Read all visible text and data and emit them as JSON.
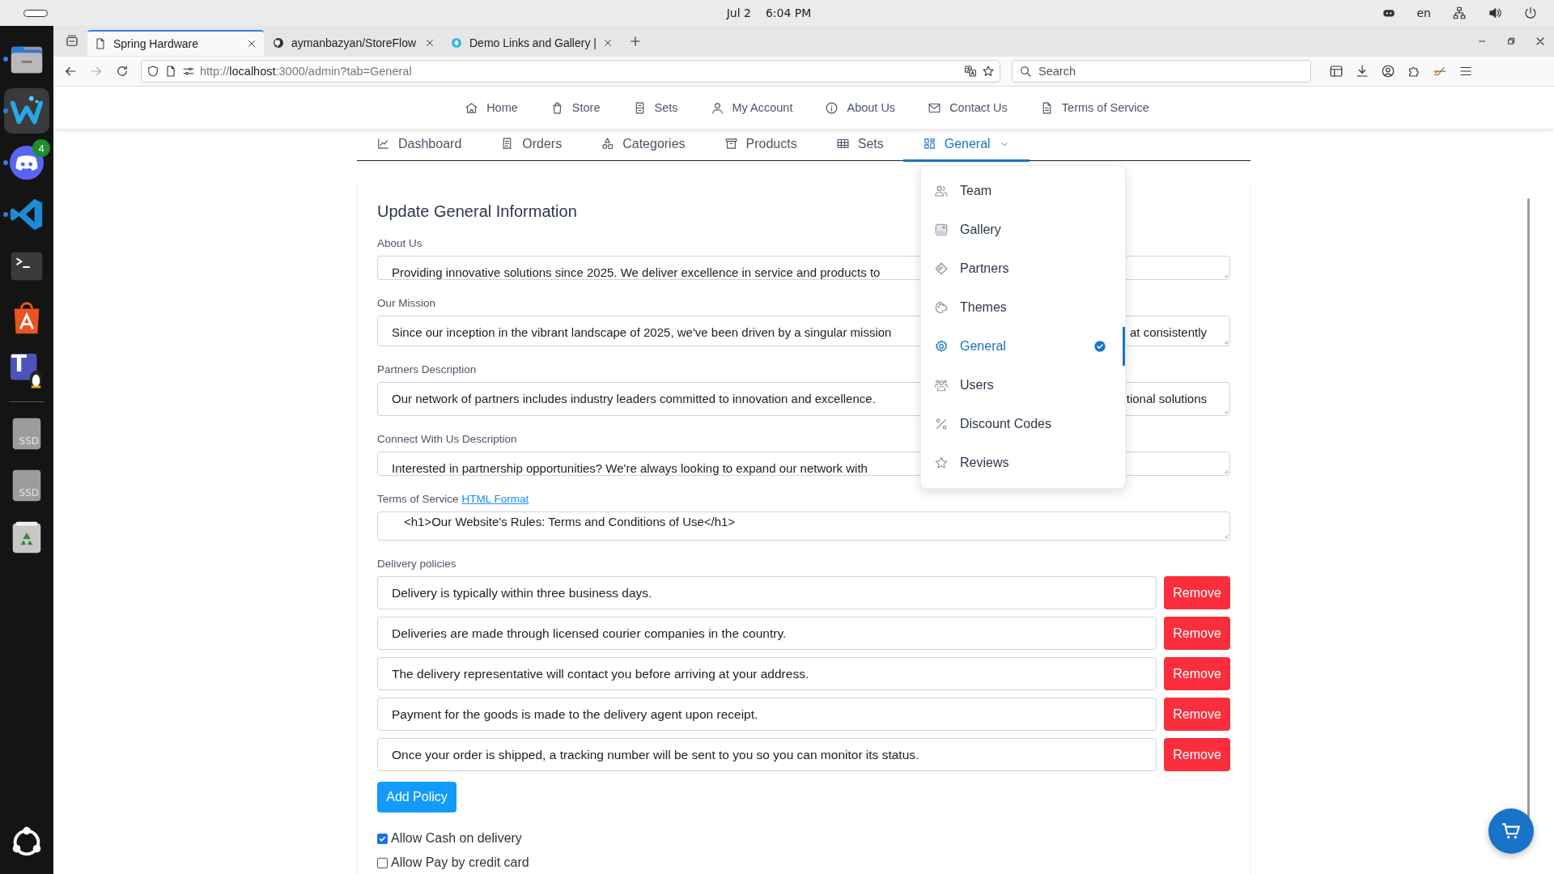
{
  "system_bar": {
    "date": "Jul 2",
    "time": "6:04 PM",
    "language": "en"
  },
  "dock": {
    "apps": [
      {
        "kind": "files",
        "running": true,
        "selected": false
      },
      {
        "kind": "wave",
        "running": true,
        "selected": true
      },
      {
        "kind": "discord",
        "running": true,
        "selected": false,
        "badge": "4"
      },
      {
        "kind": "vscode",
        "running": true,
        "selected": false
      },
      {
        "kind": "terminal",
        "running": false,
        "selected": false
      },
      {
        "kind": "appcenter",
        "running": false,
        "selected": false
      },
      {
        "kind": "teams",
        "running": false,
        "selected": false,
        "label": "T"
      }
    ],
    "drives": [
      {
        "kind": "ssd",
        "label": "SSD"
      },
      {
        "kind": "ssd",
        "label": "SSD"
      },
      {
        "kind": "trash"
      }
    ]
  },
  "browser": {
    "tabs": [
      {
        "title": "Spring Hardware",
        "kind": "page",
        "selected": true
      },
      {
        "title": "aymanbazyan/StoreFlow",
        "kind": "github",
        "selected": false
      },
      {
        "title": "Demo Links and Gallery |",
        "kind": "globe",
        "selected": false
      }
    ],
    "address": {
      "scheme": "http://",
      "host": "localhost",
      "path": ":3000/admin?tab=General"
    },
    "search": {
      "placeholder": "Search"
    }
  },
  "site_nav": [
    {
      "label": "Home"
    },
    {
      "label": "Store"
    },
    {
      "label": "Sets"
    },
    {
      "label": "My Account"
    },
    {
      "label": "About Us"
    },
    {
      "label": "Contact Us"
    },
    {
      "label": "Terms of Service"
    }
  ],
  "admin_tabs": [
    {
      "label": "Dashboard",
      "selected": false
    },
    {
      "label": "Orders",
      "selected": false
    },
    {
      "label": "Categories",
      "selected": false
    },
    {
      "label": "Products",
      "selected": false
    },
    {
      "label": "Sets",
      "selected": false
    },
    {
      "label": "General",
      "selected": true,
      "expanded": true,
      "menu": [
        {
          "label": "Team",
          "selected": false
        },
        {
          "label": "Gallery",
          "selected": false
        },
        {
          "label": "Partners",
          "selected": false
        },
        {
          "label": "Themes",
          "selected": false
        },
        {
          "label": "General",
          "selected": true
        },
        {
          "label": "Users",
          "selected": false
        },
        {
          "label": "Discount Codes",
          "selected": false
        },
        {
          "label": "Reviews",
          "selected": false
        }
      ]
    }
  ],
  "form": {
    "title": "Update General Information",
    "fields": [
      {
        "label": "About Us",
        "value": "Providing innovative solutions since 2025. We deliver excellence in service and products to"
      },
      {
        "label": "Our Mission",
        "value": "Since our inception in the vibrant landscape of 2025, we've been driven by a singular mission",
        "value_end": "at consistently"
      },
      {
        "label": "Partners Description",
        "value": "Our network of partners includes industry leaders committed to innovation and excellence.",
        "value_end": "tional solutions"
      },
      {
        "label": "Connect With Us Description",
        "value": "Interested in partnership opportunities? We're always looking to expand our network with"
      }
    ],
    "terms": {
      "label": "Terms of Service",
      "link": "HTML Format",
      "value": "<h1>Our Website's Rules: Terms and Conditions of Use</h1>"
    },
    "delivery": {
      "label": "Delivery policies",
      "policies": [
        {
          "text": "Delivery is typically within three business days.",
          "button": "Remove"
        },
        {
          "text": "Deliveries are made through licensed courier companies in the country.",
          "button": "Remove"
        },
        {
          "text": "The delivery representative will contact you before arriving at your address.",
          "button": "Remove"
        },
        {
          "text": "Payment for the goods is made to the delivery agent upon receipt.",
          "button": "Remove"
        },
        {
          "text": "Once your order is shipped, a tracking number will be sent to you so you can monitor its status.",
          "button": "Remove"
        }
      ],
      "add_button": "Add Policy"
    },
    "options": [
      {
        "label": "Allow Cash on delivery",
        "checked": true
      },
      {
        "label": "Allow Pay by credit card",
        "checked": false
      }
    ]
  }
}
